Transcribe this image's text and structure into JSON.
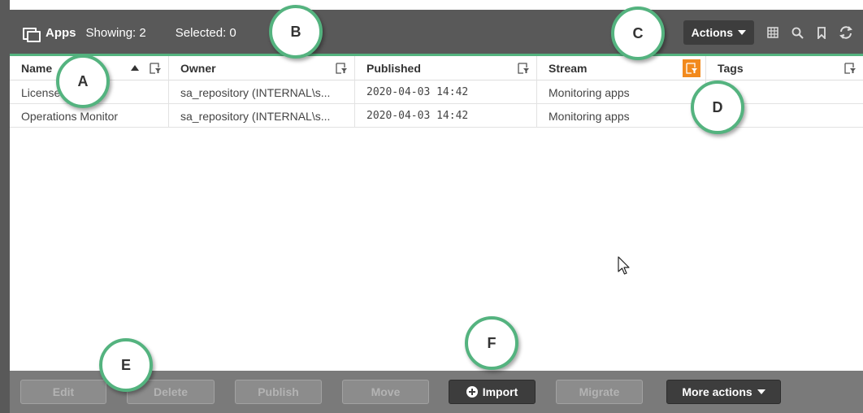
{
  "toolbar": {
    "title": "Apps",
    "showing": "Showing: 2",
    "selected": "Selected: 0",
    "actions_label": "Actions"
  },
  "table": {
    "columns": [
      {
        "label": "Name",
        "sorted": "ascending"
      },
      {
        "label": "Owner"
      },
      {
        "label": "Published"
      },
      {
        "label": "Stream",
        "filter_active": true
      },
      {
        "label": "Tags"
      }
    ],
    "rows": [
      {
        "name": "License Monitor",
        "owner": "sa_repository (INTERNAL\\s...",
        "published": "2020-04-03 14:42",
        "stream": "Monitoring apps",
        "tags": ""
      },
      {
        "name": "Operations Monitor",
        "owner": "sa_repository (INTERNAL\\s...",
        "published": "2020-04-03 14:42",
        "stream": "Monitoring apps",
        "tags": ""
      }
    ]
  },
  "bottombar": {
    "edit": "Edit",
    "delete": "Delete",
    "publish": "Publish",
    "move": "Move",
    "import": "Import",
    "migrate": "Migrate",
    "more_actions": "More actions"
  },
  "callouts": {
    "a": "A",
    "b": "B",
    "c": "C",
    "d": "D",
    "e": "E",
    "f": "F"
  },
  "colors": {
    "toolbar_bg": "#595959",
    "accent_green": "#54b37f",
    "filter_active": "#f28a1d",
    "bottombar_bg": "#7a7a7a",
    "button_dark": "#3d3d3d"
  },
  "icons": [
    "apps-icon",
    "table-view-icon",
    "search-icon",
    "bookmark-icon",
    "refresh-icon",
    "filter-icon",
    "sort-ascending-icon",
    "caret-down-icon",
    "plus-circle-icon",
    "mouse-cursor-icon"
  ]
}
